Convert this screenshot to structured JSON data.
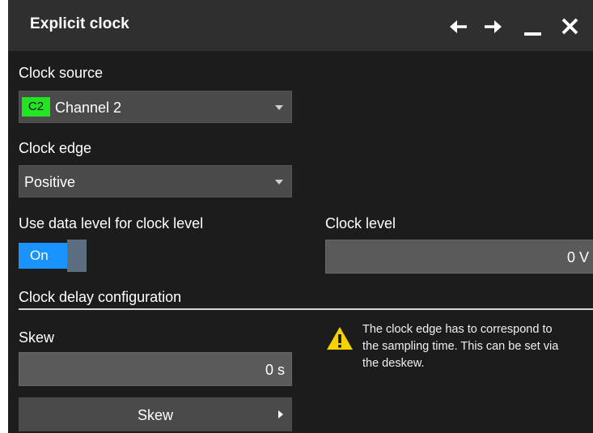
{
  "title": "Explicit clock",
  "titlebar_icons": [
    "back-arrow-icon",
    "forward-arrow-icon",
    "minimize-icon",
    "close-icon"
  ],
  "clock_source": {
    "label": "Clock source",
    "badge": "C2",
    "badge_color": "#21e521",
    "value": "Channel 2"
  },
  "clock_edge": {
    "label": "Clock edge",
    "value": "Positive"
  },
  "use_data_level": {
    "label": "Use data level for clock level",
    "state": "On",
    "accent": "#1994ff"
  },
  "clock_level": {
    "label": "Clock level",
    "value": "0 V"
  },
  "delay_section": {
    "heading": "Clock delay configuration"
  },
  "skew": {
    "label": "Skew",
    "value": "0 s",
    "button_label": "Skew"
  },
  "note": {
    "icon": "warning-icon",
    "lines": [
      "The clock edge has to correspond to",
      "the sampling time. This can be set via",
      "the deskew."
    ]
  }
}
